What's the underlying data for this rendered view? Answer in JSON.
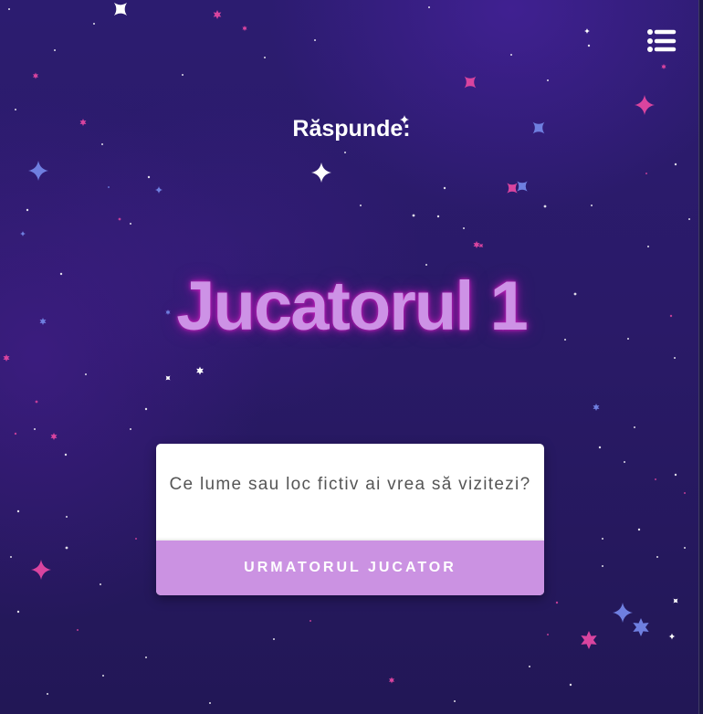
{
  "header": {
    "menu_icon": "list-menu-icon"
  },
  "prompt": {
    "label": "Răspunde:"
  },
  "player": {
    "name": "Jucatorul 1"
  },
  "card": {
    "question": "Ce lume sau loc fictiv ai vrea să vizitezi?",
    "next_button_label": "URMATORUL JUCATOR"
  },
  "colors": {
    "background": "#2a1a68",
    "player_text": "#cd92e6",
    "player_glow": "#c21fb8",
    "button": "#cb92e2",
    "question_text": "#555555",
    "star_white": "#ffffff",
    "star_pink": "#d9449f",
    "star_blue": "#6f7fe0"
  }
}
